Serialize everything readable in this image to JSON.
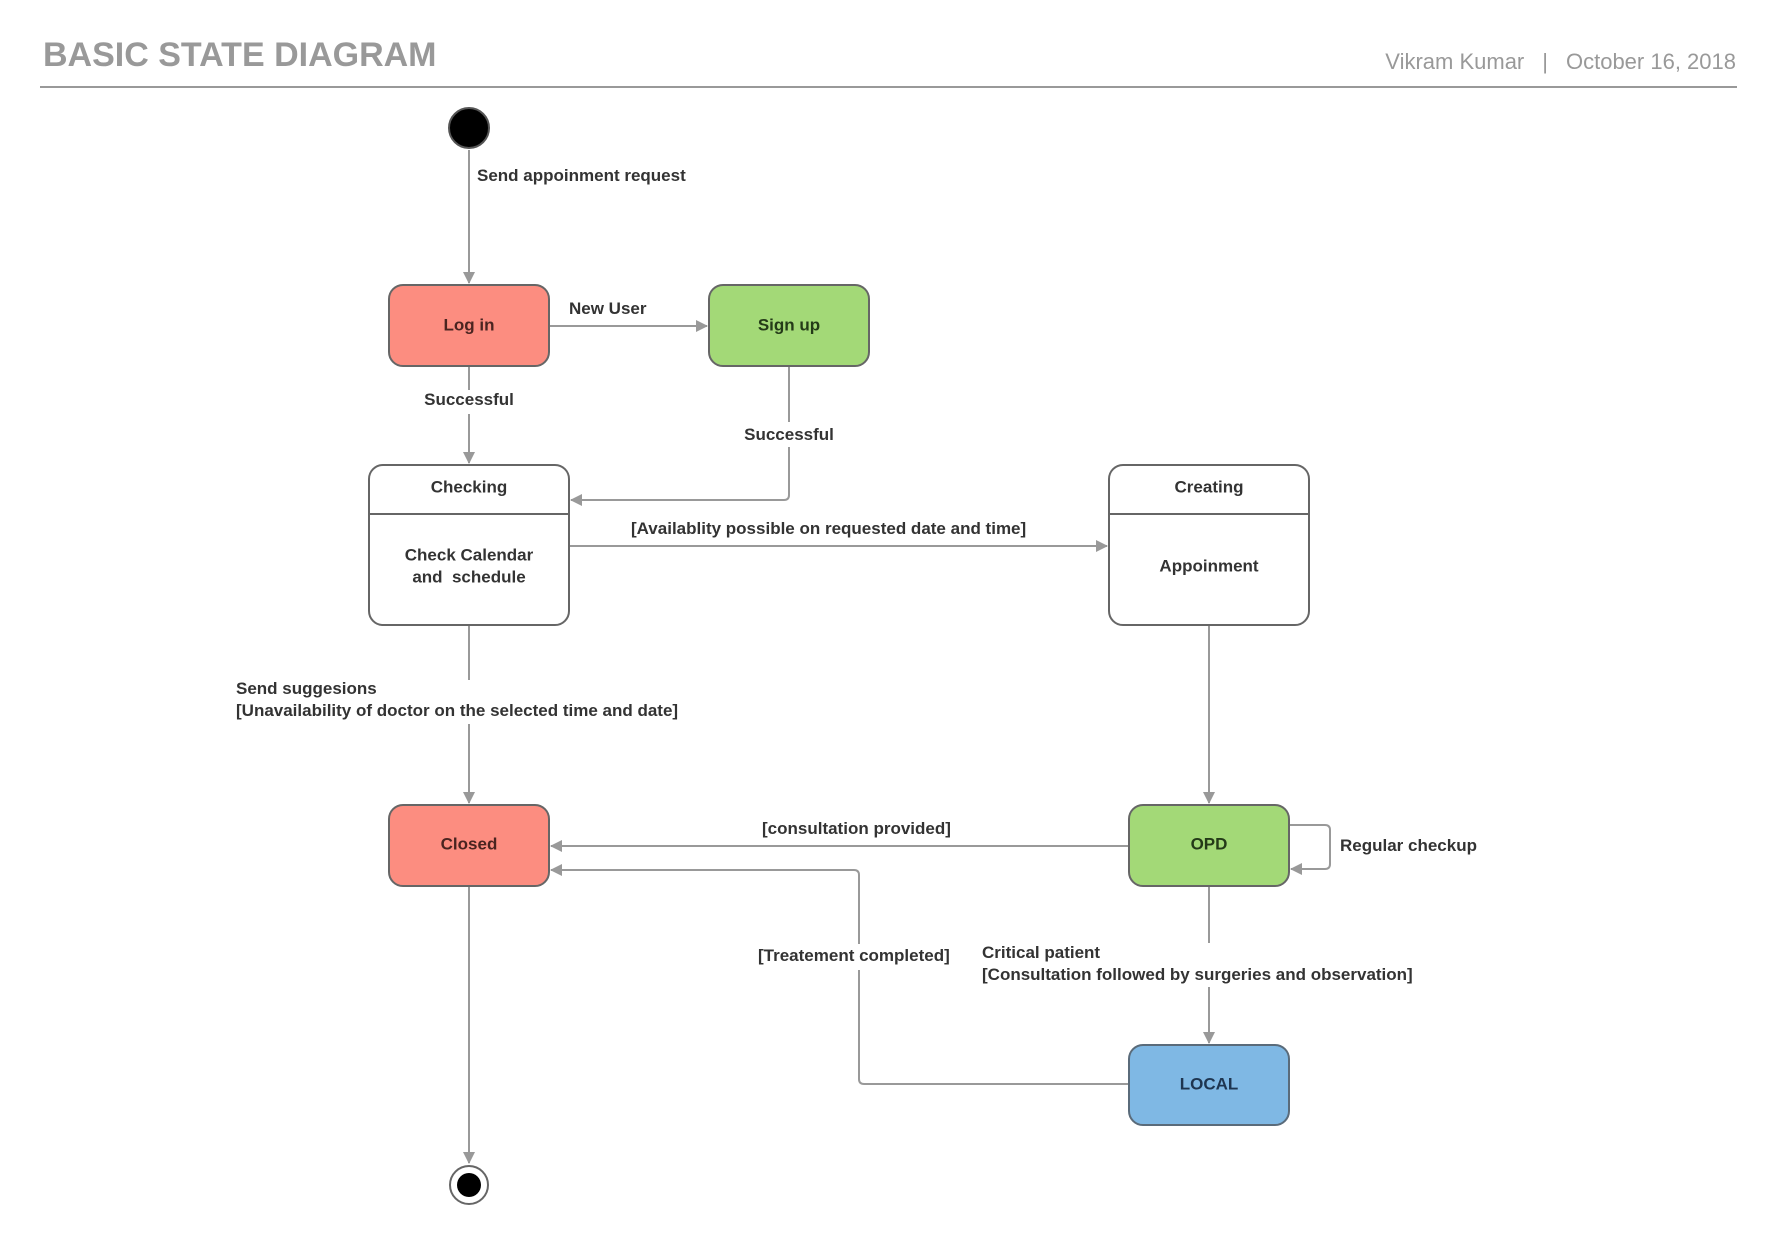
{
  "header": {
    "title": "BASIC STATE DIAGRAM",
    "author": "Vikram Kumar",
    "separator": "|",
    "date": "October 16, 2018"
  },
  "colors": {
    "red_state": "#fc8d80",
    "green_state": "#a3d977",
    "blue_state": "#7fb8e4",
    "white_state": "#ffffff",
    "stroke": "#666666",
    "edge": "#999999",
    "text": "#333333"
  },
  "states": {
    "login": {
      "label": "Log in"
    },
    "signup": {
      "label": "Sign up"
    },
    "checking": {
      "title": "Checking",
      "body_line1": "Check Calendar",
      "body_line2": "and  schedule"
    },
    "creating": {
      "title": "Creating",
      "body": "Appoinment"
    },
    "closed": {
      "label": "Closed"
    },
    "opd": {
      "label": "OPD"
    },
    "local": {
      "label": "LOCAL"
    }
  },
  "transitions": {
    "start_to_login": "Send appoinment request",
    "login_to_signup": "New User",
    "login_to_checking": "Successful",
    "signup_to_checking": "Successful",
    "checking_to_creating": "[Availablity possible on requested date and time]",
    "checking_to_closed_line1": "Send suggesions",
    "checking_to_closed_line2": "[Unavailability of doctor on the selected time and date]",
    "opd_to_closed": "[consultation provided]",
    "opd_self": "Regular checkup",
    "local_to_closed": "[Treatement completed]",
    "opd_to_local_line1": "Critical patient",
    "opd_to_local_line2": "[Consultation followed by surgeries and observation]"
  }
}
